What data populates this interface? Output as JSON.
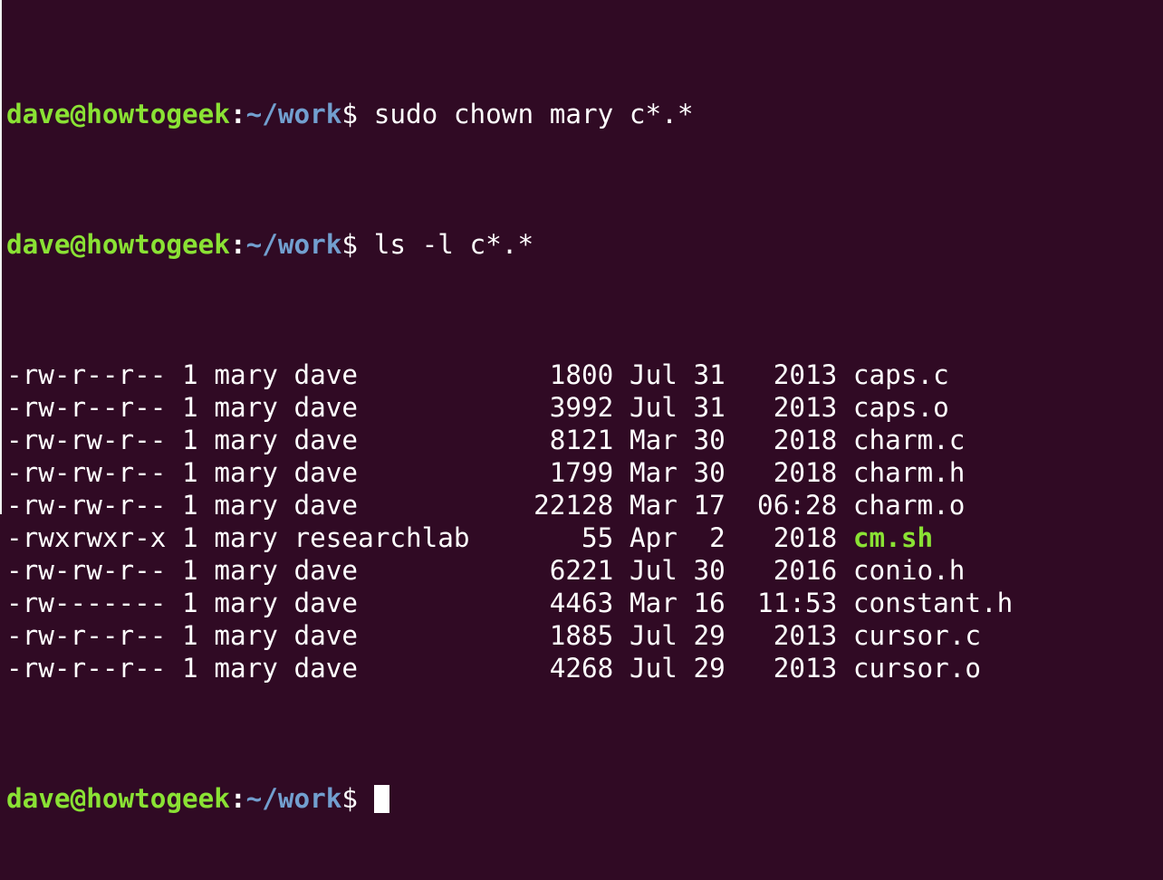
{
  "prompt": {
    "user_host": "dave@howtogeek",
    "separator": ":",
    "path": "~/work",
    "symbol": "$ "
  },
  "commands": [
    "sudo chown mary c*.*",
    "ls -l c*.*"
  ],
  "listing": [
    {
      "perms": "-rw-r--r--",
      "links": "1",
      "owner": "mary",
      "group": "dave",
      "size": "1800",
      "month": "Jul",
      "day": "31",
      "time": "2013",
      "name": "caps.c",
      "executable": false
    },
    {
      "perms": "-rw-r--r--",
      "links": "1",
      "owner": "mary",
      "group": "dave",
      "size": "3992",
      "month": "Jul",
      "day": "31",
      "time": "2013",
      "name": "caps.o",
      "executable": false
    },
    {
      "perms": "-rw-rw-r--",
      "links": "1",
      "owner": "mary",
      "group": "dave",
      "size": "8121",
      "month": "Mar",
      "day": "30",
      "time": "2018",
      "name": "charm.c",
      "executable": false
    },
    {
      "perms": "-rw-rw-r--",
      "links": "1",
      "owner": "mary",
      "group": "dave",
      "size": "1799",
      "month": "Mar",
      "day": "30",
      "time": "2018",
      "name": "charm.h",
      "executable": false
    },
    {
      "perms": "-rw-rw-r--",
      "links": "1",
      "owner": "mary",
      "group": "dave",
      "size": "22128",
      "month": "Mar",
      "day": "17",
      "time": "06:28",
      "name": "charm.o",
      "executable": false
    },
    {
      "perms": "-rwxrwxr-x",
      "links": "1",
      "owner": "mary",
      "group": "researchlab",
      "size": "55",
      "month": "Apr",
      "day": "2",
      "time": "2018",
      "name": "cm.sh",
      "executable": true
    },
    {
      "perms": "-rw-rw-r--",
      "links": "1",
      "owner": "mary",
      "group": "dave",
      "size": "6221",
      "month": "Jul",
      "day": "30",
      "time": "2016",
      "name": "conio.h",
      "executable": false
    },
    {
      "perms": "-rw-------",
      "links": "1",
      "owner": "mary",
      "group": "dave",
      "size": "4463",
      "month": "Mar",
      "day": "16",
      "time": "11:53",
      "name": "constant.h",
      "executable": false
    },
    {
      "perms": "-rw-r--r--",
      "links": "1",
      "owner": "mary",
      "group": "dave",
      "size": "1885",
      "month": "Jul",
      "day": "29",
      "time": "2013",
      "name": "cursor.c",
      "executable": false
    },
    {
      "perms": "-rw-r--r--",
      "links": "1",
      "owner": "mary",
      "group": "dave",
      "size": "4268",
      "month": "Jul",
      "day": "29",
      "time": "2013",
      "name": "cursor.o",
      "executable": false
    }
  ],
  "colors": {
    "background": "#300a24",
    "prompt_user": "#8ae234",
    "prompt_path": "#729fcf",
    "executable_file": "#8ae234",
    "text": "#ffffff"
  }
}
